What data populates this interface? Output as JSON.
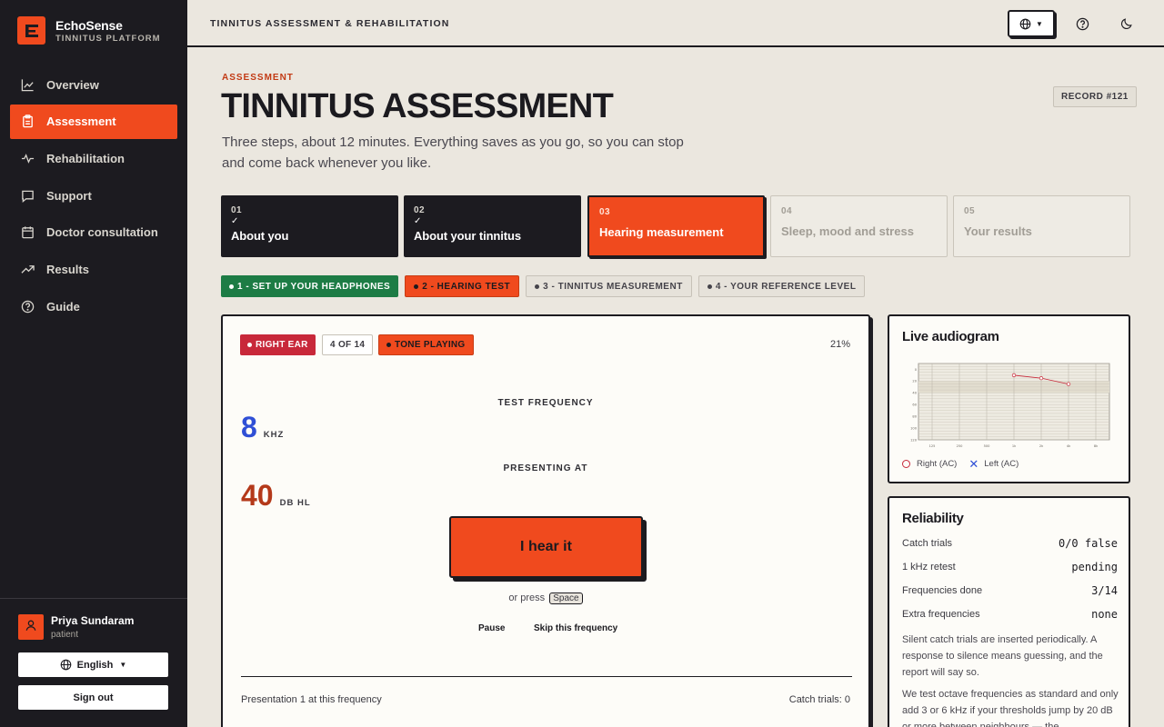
{
  "brand": {
    "name": "EchoSense",
    "subtitle": "TINNITUS PLATFORM"
  },
  "nav": [
    {
      "label": "Overview",
      "icon": "chart-line-icon",
      "active": false
    },
    {
      "label": "Assessment",
      "icon": "clipboard-icon",
      "active": true
    },
    {
      "label": "Rehabilitation",
      "icon": "pulse-icon",
      "active": false
    },
    {
      "label": "Support",
      "icon": "chat-icon",
      "active": false
    },
    {
      "label": "Doctor consultation",
      "icon": "calendar-icon",
      "active": false
    },
    {
      "label": "Results",
      "icon": "trend-up-icon",
      "active": false
    },
    {
      "label": "Guide",
      "icon": "help-circle-icon",
      "active": false
    }
  ],
  "user": {
    "name": "Priya Sundaram",
    "role": "patient"
  },
  "language": "English",
  "signout": "Sign out",
  "topbar": {
    "breadcrumb": "TINNITUS ASSESSMENT & REHABILITATION"
  },
  "page": {
    "kicker": "ASSESSMENT",
    "title": "TINNITUS ASSESSMENT",
    "subtitle": "Three steps, about 12 minutes. Everything saves as you go, so you can stop and come back whenever you like.",
    "record": "RECORD #121"
  },
  "steps": [
    {
      "num": "01",
      "label": "About you",
      "state": "done",
      "check": "✓"
    },
    {
      "num": "02",
      "label": "About your tinnitus",
      "state": "done",
      "check": "✓"
    },
    {
      "num": "03",
      "label": "Hearing measurement",
      "state": "current"
    },
    {
      "num": "04",
      "label": "Sleep, mood and stress",
      "state": "todo"
    },
    {
      "num": "05",
      "label": "Your results",
      "state": "todo"
    }
  ],
  "substeps": [
    {
      "label": "1 - SET UP YOUR HEADPHONES",
      "state": "done"
    },
    {
      "label": "2 - HEARING TEST",
      "state": "current"
    },
    {
      "label": "3 - TINNITUS MEASUREMENT",
      "state": "todo"
    },
    {
      "label": "4 - YOUR REFERENCE LEVEL",
      "state": "todo"
    }
  ],
  "test": {
    "ear": "RIGHT EAR",
    "counter": "4 OF 14",
    "status": "TONE PLAYING",
    "progress": "21%",
    "freq_label": "TEST FREQUENCY",
    "freq_value": "8",
    "freq_unit": "KHZ",
    "level_label": "PRESENTING AT",
    "level_value": "40",
    "level_unit": "DB HL",
    "button": "I hear it",
    "press_prefix": "or press",
    "press_key": "Space",
    "pause": "Pause",
    "skip": "Skip this frequency",
    "presentation": "Presentation 1 at this frequency",
    "catch": "Catch trials: 0"
  },
  "audiogram": {
    "title": "Live audiogram",
    "legend_right": "Right (AC)",
    "legend_left": "Left (AC)",
    "colors": {
      "right": "#c8283a",
      "left": "#2f4fd6"
    }
  },
  "chart_data": {
    "type": "line",
    "title": "Live audiogram",
    "x": [
      "125",
      "250",
      "500",
      "1k",
      "2k",
      "4k",
      "8k"
    ],
    "y_ticks": [
      "0",
      "20",
      "40",
      "60",
      "80",
      "100",
      "120"
    ],
    "ylim": [
      -10,
      120
    ],
    "y_inverted": true,
    "series": [
      {
        "name": "Right (AC)",
        "marker": "circle",
        "points": [
          {
            "x": "1k",
            "y": 10
          },
          {
            "x": "2k",
            "y": 15
          },
          {
            "x": "4k",
            "y": 25
          }
        ]
      },
      {
        "name": "Left (AC)",
        "marker": "cross",
        "points": []
      }
    ]
  },
  "reliability": {
    "title": "Reliability",
    "rows": [
      {
        "label": "Catch trials",
        "value": "0/0 false"
      },
      {
        "label": "1 kHz retest",
        "value": "pending"
      },
      {
        "label": "Frequencies done",
        "value": "3/14"
      },
      {
        "label": "Extra frequencies",
        "value": "none"
      }
    ],
    "note1": "Silent catch trials are inserted periodically. A response to silence means guessing, and the report will say so.",
    "note2": "We test octave frequencies as standard and only add 3 or 6 kHz if your thresholds jump by 20 dB or more between neighbours — the"
  }
}
